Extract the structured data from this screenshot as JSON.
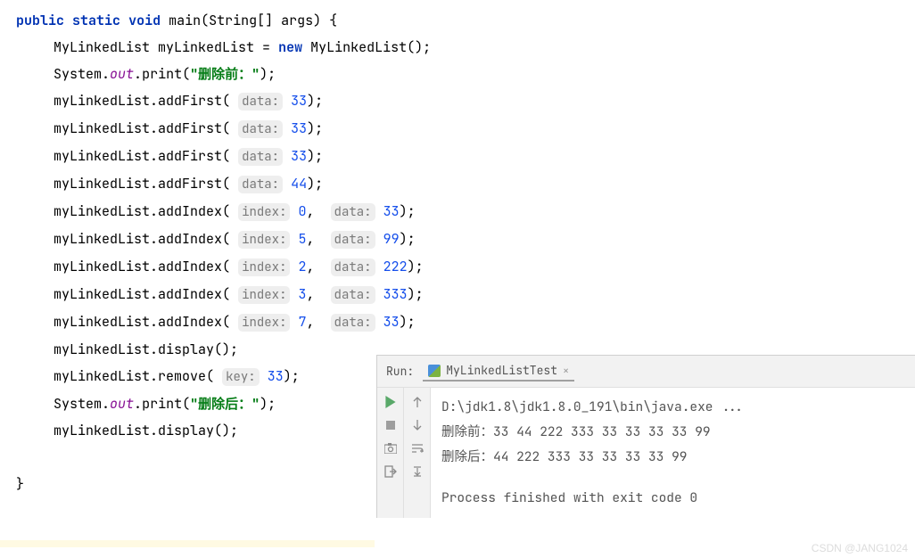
{
  "code": {
    "kw_public": "public",
    "kw_static": "static",
    "kw_void": "void",
    "kw_new": "new",
    "main": "main",
    "string_arr": "(String[] args) {",
    "type_mll": "MyLinkedList",
    "var_mll": "myLinkedList",
    "eq": " = ",
    "ctor": "MyLinkedList();",
    "system": "System",
    "out": "out",
    "print": "print",
    "str_before": "\"删除前：\"",
    "str_after": "\"删除后：\"",
    "addFirst": "addFirst",
    "addIndex": "addIndex",
    "display": "display",
    "remove": "remove",
    "hint_data": "data:",
    "hint_index": "index:",
    "hint_key": "key:",
    "v33": "33",
    "v44": "44",
    "v99": "99",
    "v222": "222",
    "v333": "333",
    "v0": "0",
    "v2": "2",
    "v3": "3",
    "v5": "5",
    "v7": "7",
    "paren_open": "(",
    "paren_close": ");",
    "paren_close_noarg": "();",
    "comma": ",",
    "dot": ".",
    "brace_close": "}"
  },
  "run": {
    "label": "Run:",
    "tab_title": "MyLinkedListTest",
    "close": "×",
    "path": "D:\\jdk1.8\\jdk1.8.0_191\\bin\\java.exe ...",
    "line_before": "删除前：33 44 222 333 33 33 33 33 99",
    "line_after": "删除后：44 222 333 33 33 33 33 99",
    "finished": "Process finished with exit code 0"
  },
  "watermark": "CSDN @JANG1024"
}
